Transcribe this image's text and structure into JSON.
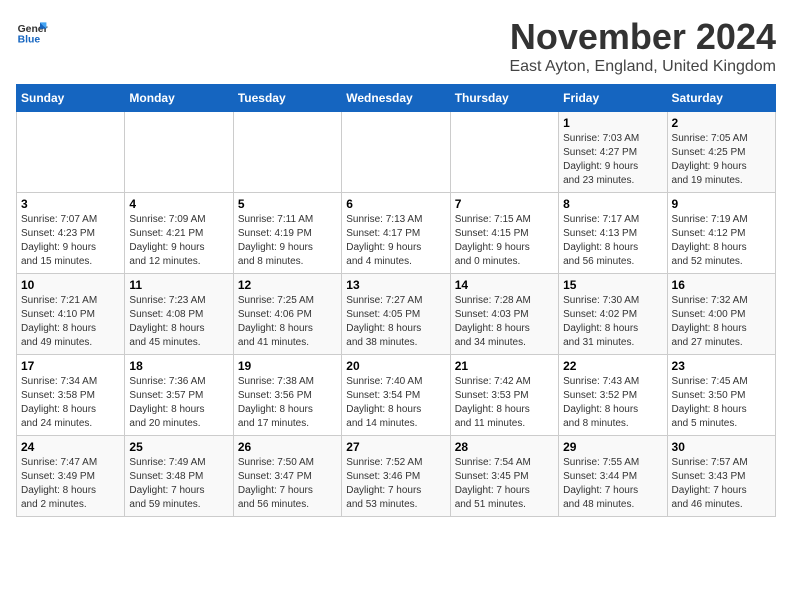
{
  "logo": {
    "line1": "General",
    "line2": "Blue"
  },
  "title": "November 2024",
  "location": "East Ayton, England, United Kingdom",
  "days_of_week": [
    "Sunday",
    "Monday",
    "Tuesday",
    "Wednesday",
    "Thursday",
    "Friday",
    "Saturday"
  ],
  "weeks": [
    [
      {
        "day": "",
        "info": ""
      },
      {
        "day": "",
        "info": ""
      },
      {
        "day": "",
        "info": ""
      },
      {
        "day": "",
        "info": ""
      },
      {
        "day": "",
        "info": ""
      },
      {
        "day": "1",
        "info": "Sunrise: 7:03 AM\nSunset: 4:27 PM\nDaylight: 9 hours\nand 23 minutes."
      },
      {
        "day": "2",
        "info": "Sunrise: 7:05 AM\nSunset: 4:25 PM\nDaylight: 9 hours\nand 19 minutes."
      }
    ],
    [
      {
        "day": "3",
        "info": "Sunrise: 7:07 AM\nSunset: 4:23 PM\nDaylight: 9 hours\nand 15 minutes."
      },
      {
        "day": "4",
        "info": "Sunrise: 7:09 AM\nSunset: 4:21 PM\nDaylight: 9 hours\nand 12 minutes."
      },
      {
        "day": "5",
        "info": "Sunrise: 7:11 AM\nSunset: 4:19 PM\nDaylight: 9 hours\nand 8 minutes."
      },
      {
        "day": "6",
        "info": "Sunrise: 7:13 AM\nSunset: 4:17 PM\nDaylight: 9 hours\nand 4 minutes."
      },
      {
        "day": "7",
        "info": "Sunrise: 7:15 AM\nSunset: 4:15 PM\nDaylight: 9 hours\nand 0 minutes."
      },
      {
        "day": "8",
        "info": "Sunrise: 7:17 AM\nSunset: 4:13 PM\nDaylight: 8 hours\nand 56 minutes."
      },
      {
        "day": "9",
        "info": "Sunrise: 7:19 AM\nSunset: 4:12 PM\nDaylight: 8 hours\nand 52 minutes."
      }
    ],
    [
      {
        "day": "10",
        "info": "Sunrise: 7:21 AM\nSunset: 4:10 PM\nDaylight: 8 hours\nand 49 minutes."
      },
      {
        "day": "11",
        "info": "Sunrise: 7:23 AM\nSunset: 4:08 PM\nDaylight: 8 hours\nand 45 minutes."
      },
      {
        "day": "12",
        "info": "Sunrise: 7:25 AM\nSunset: 4:06 PM\nDaylight: 8 hours\nand 41 minutes."
      },
      {
        "day": "13",
        "info": "Sunrise: 7:27 AM\nSunset: 4:05 PM\nDaylight: 8 hours\nand 38 minutes."
      },
      {
        "day": "14",
        "info": "Sunrise: 7:28 AM\nSunset: 4:03 PM\nDaylight: 8 hours\nand 34 minutes."
      },
      {
        "day": "15",
        "info": "Sunrise: 7:30 AM\nSunset: 4:02 PM\nDaylight: 8 hours\nand 31 minutes."
      },
      {
        "day": "16",
        "info": "Sunrise: 7:32 AM\nSunset: 4:00 PM\nDaylight: 8 hours\nand 27 minutes."
      }
    ],
    [
      {
        "day": "17",
        "info": "Sunrise: 7:34 AM\nSunset: 3:58 PM\nDaylight: 8 hours\nand 24 minutes."
      },
      {
        "day": "18",
        "info": "Sunrise: 7:36 AM\nSunset: 3:57 PM\nDaylight: 8 hours\nand 20 minutes."
      },
      {
        "day": "19",
        "info": "Sunrise: 7:38 AM\nSunset: 3:56 PM\nDaylight: 8 hours\nand 17 minutes."
      },
      {
        "day": "20",
        "info": "Sunrise: 7:40 AM\nSunset: 3:54 PM\nDaylight: 8 hours\nand 14 minutes."
      },
      {
        "day": "21",
        "info": "Sunrise: 7:42 AM\nSunset: 3:53 PM\nDaylight: 8 hours\nand 11 minutes."
      },
      {
        "day": "22",
        "info": "Sunrise: 7:43 AM\nSunset: 3:52 PM\nDaylight: 8 hours\nand 8 minutes."
      },
      {
        "day": "23",
        "info": "Sunrise: 7:45 AM\nSunset: 3:50 PM\nDaylight: 8 hours\nand 5 minutes."
      }
    ],
    [
      {
        "day": "24",
        "info": "Sunrise: 7:47 AM\nSunset: 3:49 PM\nDaylight: 8 hours\nand 2 minutes."
      },
      {
        "day": "25",
        "info": "Sunrise: 7:49 AM\nSunset: 3:48 PM\nDaylight: 7 hours\nand 59 minutes."
      },
      {
        "day": "26",
        "info": "Sunrise: 7:50 AM\nSunset: 3:47 PM\nDaylight: 7 hours\nand 56 minutes."
      },
      {
        "day": "27",
        "info": "Sunrise: 7:52 AM\nSunset: 3:46 PM\nDaylight: 7 hours\nand 53 minutes."
      },
      {
        "day": "28",
        "info": "Sunrise: 7:54 AM\nSunset: 3:45 PM\nDaylight: 7 hours\nand 51 minutes."
      },
      {
        "day": "29",
        "info": "Sunrise: 7:55 AM\nSunset: 3:44 PM\nDaylight: 7 hours\nand 48 minutes."
      },
      {
        "day": "30",
        "info": "Sunrise: 7:57 AM\nSunset: 3:43 PM\nDaylight: 7 hours\nand 46 minutes."
      }
    ]
  ]
}
